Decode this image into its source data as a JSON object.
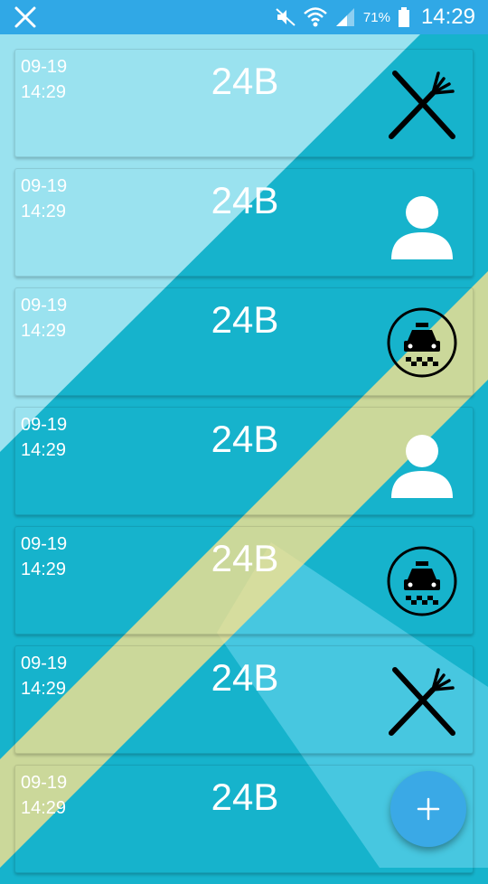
{
  "colors": {
    "status_bar": "#30a8e6",
    "background": "#16b3cc",
    "light_band": "#a6e6f2",
    "yellow_band": "#ffe38c",
    "fab": "#3aa9e6",
    "text": "#ffffff",
    "icon": "#000000"
  },
  "status_bar": {
    "notification_icon": "fork-knife-icon",
    "battery_percent": "71%",
    "clock": "14:29"
  },
  "items": [
    {
      "date": "09-19",
      "time": "14:29",
      "code": "24B",
      "icon": "fork-knife-icon"
    },
    {
      "date": "09-19",
      "time": "14:29",
      "code": "24B",
      "icon": "person-icon"
    },
    {
      "date": "09-19",
      "time": "14:29",
      "code": "24B",
      "icon": "taxi-icon"
    },
    {
      "date": "09-19",
      "time": "14:29",
      "code": "24B",
      "icon": "person-icon"
    },
    {
      "date": "09-19",
      "time": "14:29",
      "code": "24B",
      "icon": "taxi-icon"
    },
    {
      "date": "09-19",
      "time": "14:29",
      "code": "24B",
      "icon": "fork-knife-icon"
    },
    {
      "date": "09-19",
      "time": "14:29",
      "code": "24B",
      "icon": "fork-knife-icon"
    }
  ],
  "fab": {
    "icon": "plus-icon"
  }
}
